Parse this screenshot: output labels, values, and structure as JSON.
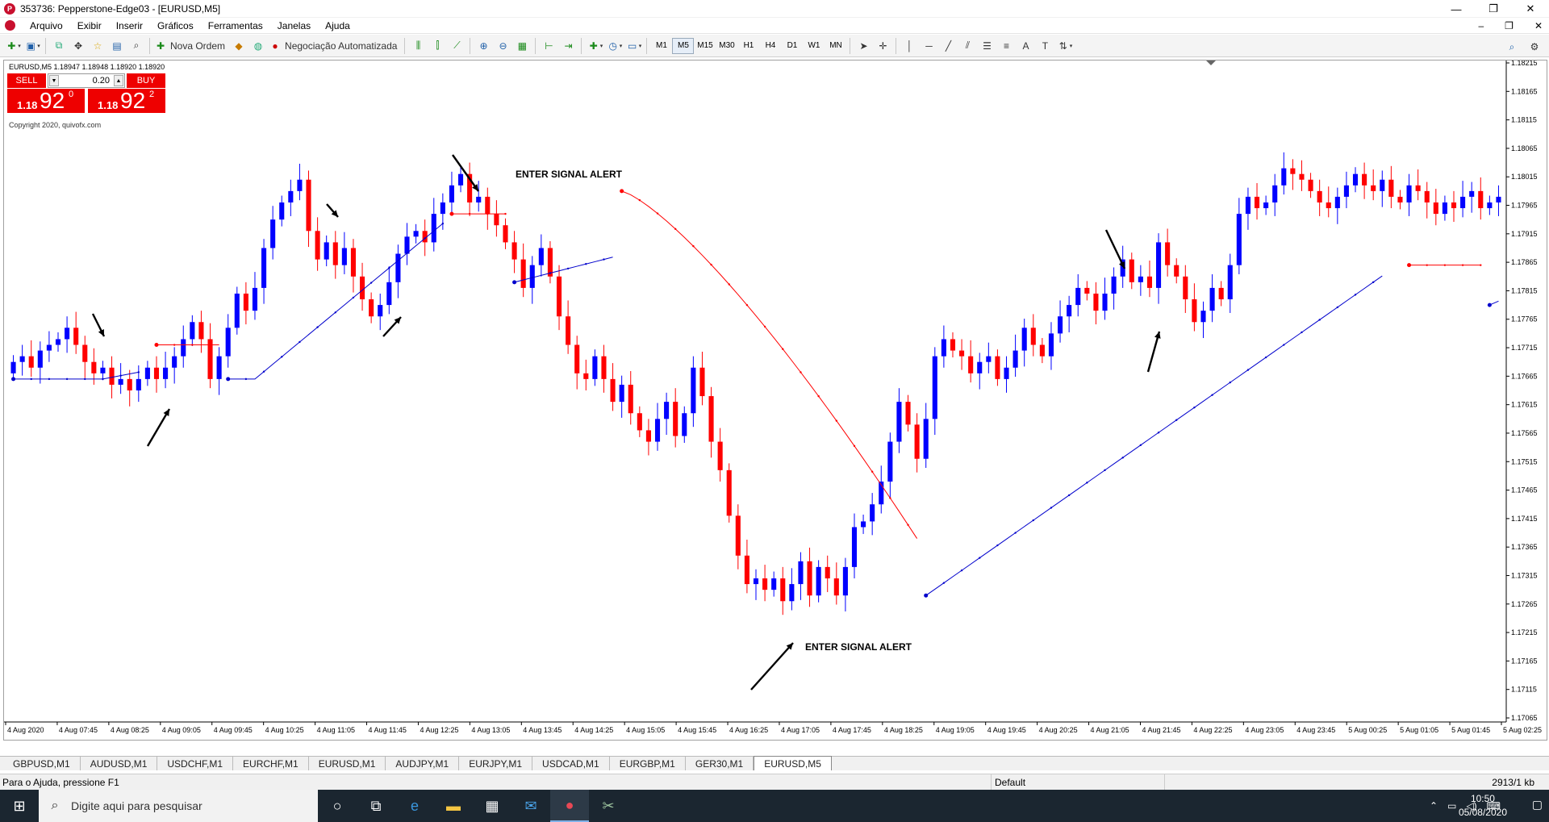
{
  "window": {
    "title": "353736: Pepperstone-Edge03 - [EURUSD,M5]",
    "min": "—",
    "max": "❐",
    "close": "✕"
  },
  "menu": {
    "items": [
      "Arquivo",
      "Exibir",
      "Inserir",
      "Gráficos",
      "Ferramentas",
      "Janelas",
      "Ajuda"
    ],
    "mdi_min": "–",
    "mdi_max": "❐",
    "mdi_close": "✕"
  },
  "toolbar": {
    "new_order": "Nova Ordem",
    "algo_trading": "Negociação Automatizada",
    "timeframes": [
      "M1",
      "M5",
      "M15",
      "M30",
      "H1",
      "H4",
      "D1",
      "W1",
      "MN"
    ],
    "active_timeframe": "M5"
  },
  "chart": {
    "symbol_info": "EURUSD,M5  1.18947 1.18948 1.18920 1.18920",
    "copyright": "Copyright 2020, quivofx.com",
    "annotations": [
      "ENTER SIGNAL ALERT",
      "ENTER SIGNAL ALERT"
    ]
  },
  "trade_panel": {
    "sell_label": "SELL",
    "buy_label": "BUY",
    "volume": "0.20",
    "sell_small": "1.18",
    "sell_big": "92",
    "sell_sup": "0",
    "buy_small": "1.18",
    "buy_big": "92",
    "buy_sup": "2"
  },
  "chart_data": {
    "type": "candlestick",
    "symbol": "EURUSD",
    "timeframe": "M5",
    "y_ticks": [
      "1.18215",
      "1.18165",
      "1.18115",
      "1.18065",
      "1.18015",
      "1.17965",
      "1.17915",
      "1.17865",
      "1.17815",
      "1.17765",
      "1.17715",
      "1.17665",
      "1.17615",
      "1.17565",
      "1.17515",
      "1.17465",
      "1.17415",
      "1.17365",
      "1.17315",
      "1.17265",
      "1.17215",
      "1.17165",
      "1.17115",
      "1.17065"
    ],
    "ylim": [
      1.17065,
      1.18215
    ],
    "x_ticks": [
      "4 Aug 2020",
      "4 Aug 07:45",
      "4 Aug 08:25",
      "4 Aug 09:05",
      "4 Aug 09:45",
      "4 Aug 10:25",
      "4 Aug 11:05",
      "4 Aug 11:45",
      "4 Aug 12:25",
      "4 Aug 13:05",
      "4 Aug 13:45",
      "4 Aug 14:25",
      "4 Aug 15:05",
      "4 Aug 15:45",
      "4 Aug 16:25",
      "4 Aug 17:05",
      "4 Aug 17:45",
      "4 Aug 18:25",
      "4 Aug 19:05",
      "4 Aug 19:45",
      "4 Aug 20:25",
      "4 Aug 21:05",
      "4 Aug 21:45",
      "4 Aug 22:25",
      "4 Aug 23:05",
      "4 Aug 23:45",
      "5 Aug 00:25",
      "5 Aug 01:05",
      "5 Aug 01:45",
      "5 Aug 02:25"
    ],
    "close_series": [
      1.1769,
      1.177,
      1.1768,
      1.1771,
      1.1772,
      1.1773,
      1.1775,
      1.1772,
      1.1769,
      1.1767,
      1.1768,
      1.1765,
      1.1766,
      1.1764,
      1.1766,
      1.1768,
      1.1766,
      1.1768,
      1.177,
      1.1773,
      1.1776,
      1.1773,
      1.1766,
      1.177,
      1.1775,
      1.1781,
      1.1778,
      1.1782,
      1.1789,
      1.1794,
      1.1797,
      1.1799,
      1.1801,
      1.1792,
      1.1787,
      1.179,
      1.1786,
      1.1789,
      1.1784,
      1.178,
      1.1777,
      1.1779,
      1.1783,
      1.1788,
      1.1791,
      1.1792,
      1.179,
      1.1795,
      1.1797,
      1.18,
      1.1802,
      1.1797,
      1.1798,
      1.1795,
      1.1793,
      1.179,
      1.1787,
      1.1782,
      1.1786,
      1.1789,
      1.1784,
      1.1777,
      1.1772,
      1.1767,
      1.1766,
      1.177,
      1.1766,
      1.1762,
      1.1765,
      1.176,
      1.1757,
      1.1755,
      1.1759,
      1.1762,
      1.1756,
      1.176,
      1.1768,
      1.1763,
      1.1755,
      1.175,
      1.1742,
      1.1735,
      1.173,
      1.1731,
      1.1729,
      1.1731,
      1.1727,
      1.173,
      1.1734,
      1.1728,
      1.1733,
      1.1731,
      1.1728,
      1.1733,
      1.174,
      1.1741,
      1.1744,
      1.1748,
      1.1755,
      1.1762,
      1.1758,
      1.1752,
      1.1759,
      1.177,
      1.1773,
      1.1771,
      1.177,
      1.1767,
      1.1769,
      1.177,
      1.1766,
      1.1768,
      1.1771,
      1.1775,
      1.1772,
      1.177,
      1.1774,
      1.1777,
      1.1779,
      1.1782,
      1.1781,
      1.1778,
      1.1781,
      1.1784,
      1.1787,
      1.1783,
      1.1784,
      1.1782,
      1.179,
      1.1786,
      1.1784,
      1.178,
      1.1776,
      1.1778,
      1.1782,
      1.178,
      1.1786,
      1.1795,
      1.1798,
      1.1796,
      1.1797,
      1.18,
      1.1803,
      1.1802,
      1.1801,
      1.1799,
      1.1797,
      1.1796,
      1.1798,
      1.18,
      1.1802,
      1.18,
      1.1799,
      1.1801,
      1.1798,
      1.1797,
      1.18,
      1.1799,
      1.1797,
      1.1795,
      1.1797,
      1.1796,
      1.1798,
      1.1799,
      1.1796,
      1.1797,
      1.1798
    ],
    "indicators": [
      {
        "name": "red_trailing_stop",
        "color": "#ff0000"
      },
      {
        "name": "blue_trailing_stop",
        "color": "#0000cc"
      }
    ],
    "bull_color": "#0000ff",
    "bear_color": "#ff0000"
  },
  "symbol_tabs": {
    "items": [
      "GBPUSD,M1",
      "AUDUSD,M1",
      "USDCHF,M1",
      "EURCHF,M1",
      "EURUSD,M1",
      "AUDJPY,M1",
      "EURJPY,M1",
      "USDCAD,M1",
      "EURGBP,M1",
      "GER30,M1",
      "EURUSD,M5"
    ],
    "active": "EURUSD,M5"
  },
  "statusbar": {
    "help": "Para o Ajuda, pressione F1",
    "profile": "Default",
    "traffic": "2913/1 kb"
  },
  "taskbar": {
    "search_placeholder": "Digite aqui para pesquisar",
    "time": "10:50",
    "date": "05/08/2020"
  }
}
